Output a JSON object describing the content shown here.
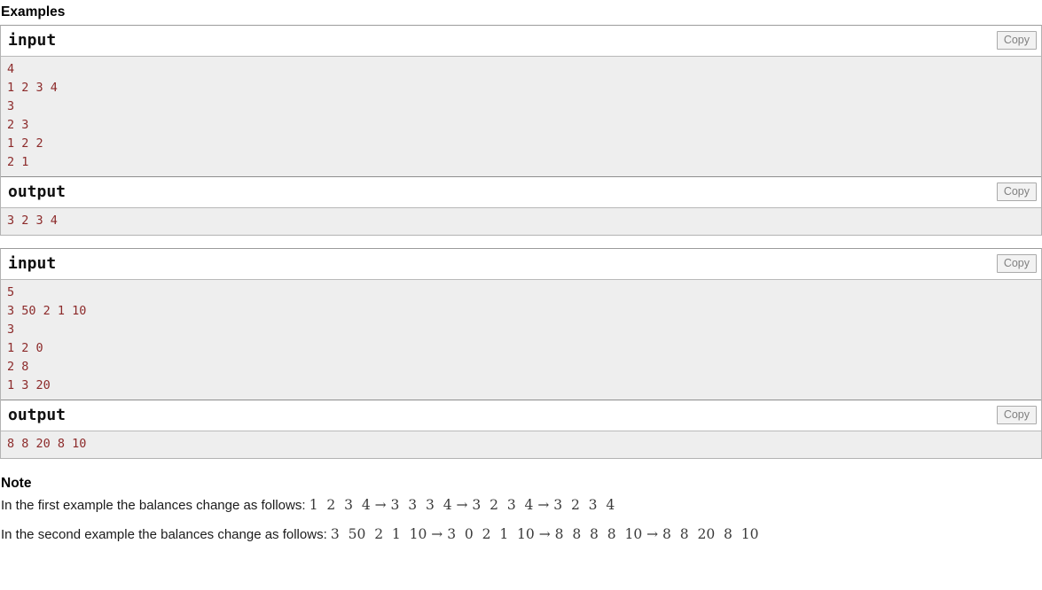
{
  "examples": {
    "heading": "Examples",
    "copy_label": "Copy",
    "blocks": [
      {
        "input_label": "input",
        "input_text": "4\n1 2 3 4\n3\n2 3\n1 2 2\n2 1",
        "output_label": "output",
        "output_text": "3 2 3 4"
      },
      {
        "input_label": "input",
        "input_text": "5\n3 50 2 1 10\n3\n1 2 0\n2 8\n1 3 20",
        "output_label": "output",
        "output_text": "8 8 20 8 10"
      }
    ]
  },
  "note": {
    "heading": "Note",
    "paragraphs": [
      {
        "text": "In the first example the balances change as follows: ",
        "math": "1  2  3  4 → 3  3  3  4 → 3  2  3  4 → 3  2  3  4"
      },
      {
        "text": "In the second example the balances change as follows: ",
        "math": "3  50  2  1  10 → 3  0  2  1  10 → 8  8  8  8  10 → 8  8  20  8  10"
      }
    ]
  },
  "colors": {
    "sample_text": "#8c2a2a",
    "sample_bg": "#eeeeee",
    "border": "#b3b3b3",
    "copy_text": "#808080",
    "math_text": "#3b3b3b"
  }
}
